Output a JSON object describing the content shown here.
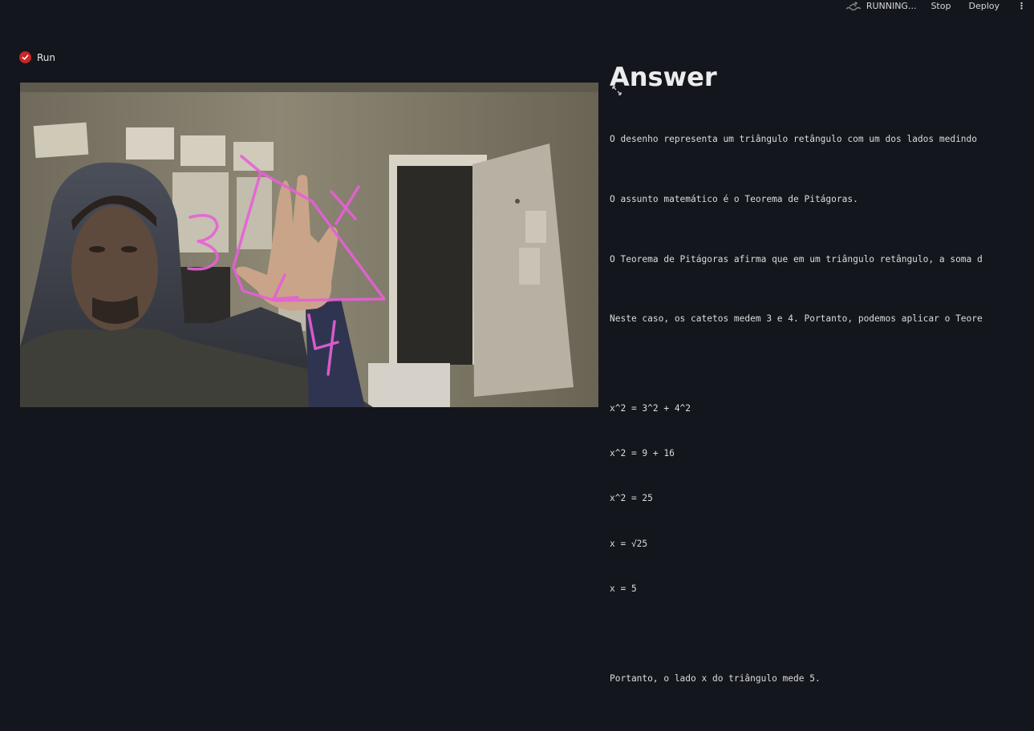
{
  "topbar": {
    "status": "RUNNING...",
    "stop_label": "Stop",
    "deploy_label": "Deploy",
    "menu_icon": "kebab-menu-icon"
  },
  "run": {
    "label": "Run",
    "checked": true
  },
  "answer": {
    "title": "Answer",
    "paragraphs": [
      "O desenho representa um triângulo retângulo com um dos lados medindo",
      "O assunto matemático é o Teorema de Pitágoras.",
      "O Teorema de Pitágoras afirma que em um triângulo retângulo, a soma d",
      "Neste caso, os catetos medem 3 e 4. Portanto, podemos aplicar o Teore"
    ],
    "math_lines": [
      "x^2 = 3^2 + 4^2",
      "x^2 = 9 + 16",
      "x^2 = 25",
      "x = √25",
      "x = 5"
    ],
    "conclusion": "Portanto, o lado x do triângulo mede 5."
  },
  "drawing": {
    "labels": [
      "3",
      "x",
      "4"
    ],
    "stroke_color": "#e85fd8"
  },
  "colors": {
    "background": "#13161c",
    "accent": "#c92626"
  }
}
